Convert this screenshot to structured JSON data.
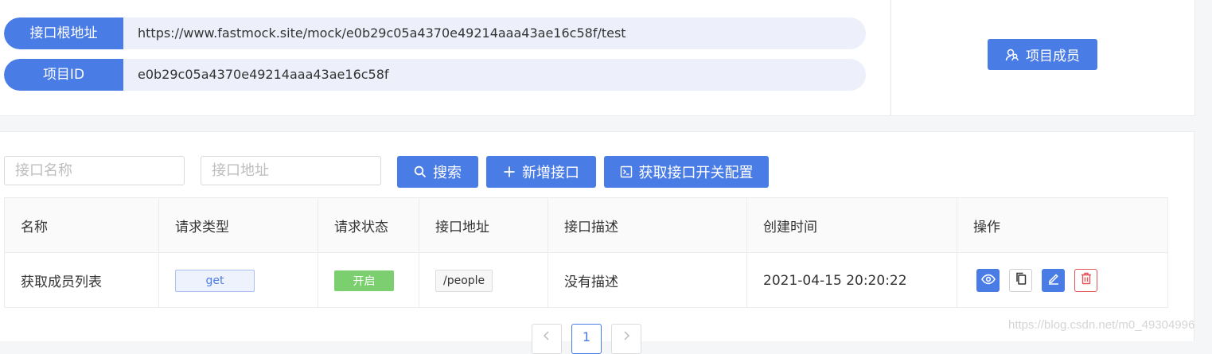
{
  "project": {
    "rows": [
      {
        "label": "接口根地址",
        "value": "https://www.fastmock.site/mock/e0b29c05a4370e49214aaa43ae16c58f/test"
      },
      {
        "label": "项目ID",
        "value": "e0b29c05a4370e49214aaa43ae16c58f"
      }
    ],
    "members_button": "项目成员"
  },
  "filters": {
    "name_placeholder": "接口名称",
    "path_placeholder": "接口地址",
    "search_button": "搜索",
    "add_button": "新增接口",
    "config_button": "获取接口开关配置"
  },
  "table": {
    "columns": [
      "名称",
      "请求类型",
      "请求状态",
      "接口地址",
      "接口描述",
      "创建时间",
      "操作"
    ],
    "rows": [
      {
        "name": "获取成员列表",
        "method": "get",
        "status": "开启",
        "path": "/people",
        "description": "没有描述",
        "created": "2021-04-15 20:20:22"
      }
    ]
  },
  "pagination": {
    "current": "1",
    "prev_icon": "chevron-left-icon",
    "next_icon": "chevron-right-icon"
  },
  "watermark": "https://blog.csdn.net/m0_49304996",
  "colors": {
    "primary": "#4a7ce6",
    "success": "#7ccf6f",
    "danger": "#e4555a"
  }
}
